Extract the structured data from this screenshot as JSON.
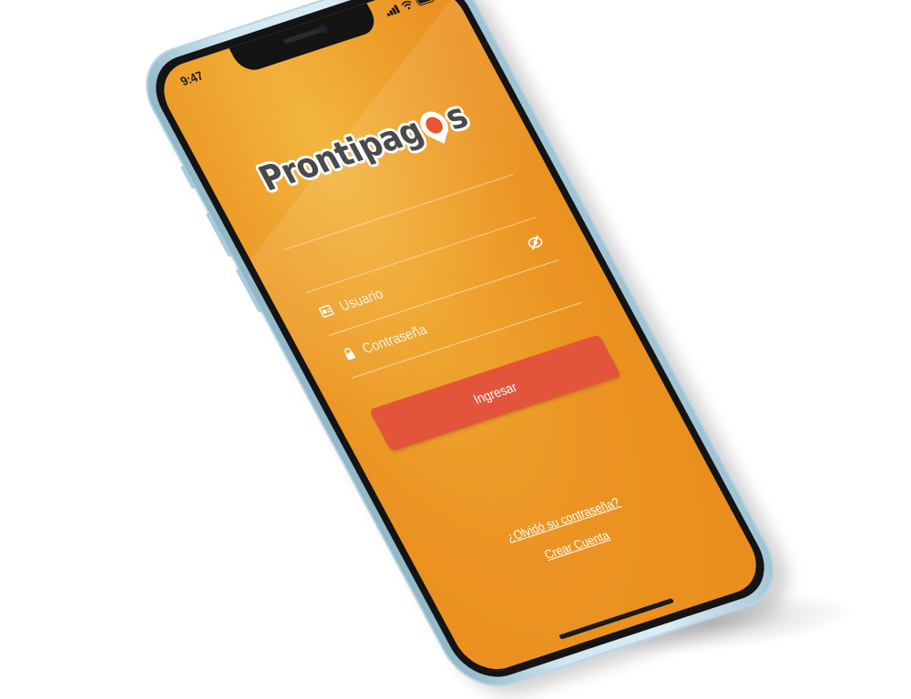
{
  "status_bar": {
    "time": "9:47"
  },
  "logo": {
    "text_before": "Prontipag",
    "text_after": "s"
  },
  "login_form": {
    "username_placeholder": "Usuario",
    "password_placeholder": "Contraseña",
    "submit_label": "Ingresar"
  },
  "links": {
    "forgot_password": "¿Olvidó su contraseña?",
    "create_account": "Crear Cuenta"
  },
  "colors": {
    "screen_orange": "#eb9322",
    "button_red": "#e2553a",
    "frame_blue": "#cfe6f1"
  },
  "icons": [
    "signal-icon",
    "wifi-icon",
    "battery-icon",
    "id-card-icon",
    "lock-icon",
    "eye-off-icon",
    "location-pin-icon"
  ]
}
